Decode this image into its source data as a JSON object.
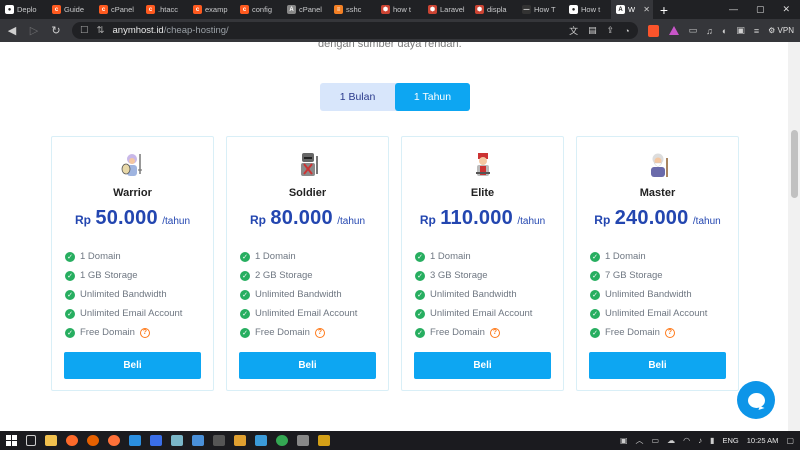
{
  "browser": {
    "tabs": [
      {
        "title": "Deplo",
        "fav_color": "#ffffff",
        "fav_glyph": "●"
      },
      {
        "title": "Guide",
        "fav_color": "#ff5a1f",
        "fav_glyph": "c"
      },
      {
        "title": "cPanel",
        "fav_color": "#ff5a1f",
        "fav_glyph": "c"
      },
      {
        "title": ".htacc",
        "fav_color": "#ff5a1f",
        "fav_glyph": "c"
      },
      {
        "title": "examp",
        "fav_color": "#ff5a1f",
        "fav_glyph": "c"
      },
      {
        "title": "config",
        "fav_color": "#ff5a1f",
        "fav_glyph": "c"
      },
      {
        "title": "cPanel",
        "fav_color": "#888888",
        "fav_glyph": "A"
      },
      {
        "title": "sshc",
        "fav_color": "#f48024",
        "fav_glyph": "≡"
      },
      {
        "title": "how t",
        "fav_color": "#c43",
        "fav_glyph": "⬢"
      },
      {
        "title": "Laravel",
        "fav_color": "#c43",
        "fav_glyph": "⬢"
      },
      {
        "title": "displa",
        "fav_color": "#c43",
        "fav_glyph": "⬢"
      },
      {
        "title": "How T",
        "fav_color": "#333",
        "fav_glyph": "—"
      },
      {
        "title": "How t",
        "fav_color": "#fff",
        "fav_glyph": "●"
      },
      {
        "title": "W",
        "fav_color": "#fff",
        "fav_glyph": "A",
        "active": true
      }
    ],
    "new_tab": "+",
    "window_controls": {
      "minimize": "—",
      "maximize": "▢",
      "close": "✕"
    },
    "url_host": "anymhost.id",
    "url_path": "/cheap-hosting/",
    "vpn_label": "VPN"
  },
  "page": {
    "intro_text": "dengan sumber daya rendah.",
    "billing_toggle": {
      "monthly": "1 Bulan",
      "yearly": "1 Tahun",
      "selected": "yearly"
    },
    "plans": [
      {
        "name": "Warrior",
        "currency": "Rp",
        "price": "50.000",
        "period": "/tahun",
        "features": [
          "1 Domain",
          "1 GB Storage",
          "Unlimited Bandwidth",
          "Unlimited Email Account",
          "Free Domain"
        ],
        "button": "Beli",
        "avatar": "warrior-icon"
      },
      {
        "name": "Soldier",
        "currency": "Rp",
        "price": "80.000",
        "period": "/tahun",
        "features": [
          "1 Domain",
          "2 GB Storage",
          "Unlimited Bandwidth",
          "Unlimited Email Account",
          "Free Domain"
        ],
        "button": "Beli",
        "avatar": "soldier-icon"
      },
      {
        "name": "Elite",
        "currency": "Rp",
        "price": "110.000",
        "period": "/tahun",
        "features": [
          "1 Domain",
          "3 GB Storage",
          "Unlimited Bandwidth",
          "Unlimited Email Account",
          "Free Domain"
        ],
        "button": "Beli",
        "avatar": "elite-icon"
      },
      {
        "name": "Master",
        "currency": "Rp",
        "price": "240.000",
        "period": "/tahun",
        "features": [
          "1 Domain",
          "7 GB Storage",
          "Unlimited Bandwidth",
          "Unlimited Email Account",
          "Free Domain"
        ],
        "button": "Beli",
        "avatar": "master-icon"
      }
    ],
    "colors": {
      "accent": "#0da6f2",
      "price": "#2346b0",
      "check": "#27ae60",
      "help": "#ff7a1a"
    }
  },
  "taskbar": {
    "language": "ENG",
    "time": "10:25 AM"
  }
}
